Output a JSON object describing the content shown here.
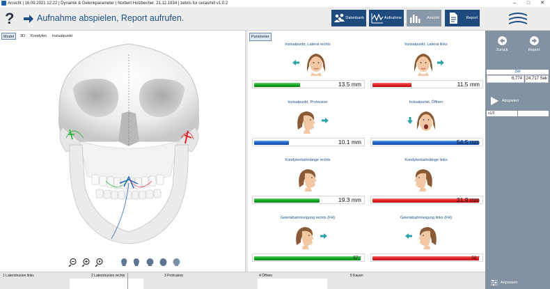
{
  "titlebar": {
    "text": "Ansicht | 16.09.2021 12:22 | Dynamik & Gelenkparameter | Norbert Holzbecher, 21.12.1934 | zebris for cerasmill v1.0.2",
    "minimize": "–",
    "maximize": "□",
    "close": "✕"
  },
  "header": {
    "help_icon": "?",
    "headline": "Aufnahme abspielen, Report aufrufen.",
    "buttons": [
      {
        "label": "Datenbank",
        "icon": "users-icon"
      },
      {
        "label": "Aufnahme",
        "icon": "wave-icon"
      },
      {
        "label": "Ansicht",
        "icon": "bars-icon",
        "active": true
      },
      {
        "label": "Report",
        "icon": "document-icon"
      }
    ]
  },
  "view_tabs": [
    "Model",
    "3D",
    "Kondylen",
    "Inzisalpunkt"
  ],
  "parameter_tab": "Parameter",
  "params": [
    {
      "label": "Inzisalpunkt, Lateral rechts",
      "value": "13.5 mm",
      "color": "#15a322",
      "fill": 0.42
    },
    {
      "label": "Inzisalpunkt, Lateral links",
      "value": "11.5 mm",
      "color": "#e41f24",
      "fill": 0.36
    },
    {
      "label": "Inzisalpunkt, Protrusion",
      "value": "10.1 mm",
      "color": "#1f63c7",
      "fill": 0.32
    },
    {
      "label": "Inzisalpunkt, Öffnen",
      "value": "54.5 mm",
      "color": "#1f63c7",
      "fill": 0.98
    },
    {
      "label": "Kondylenbahnlänge rechts",
      "value": "19.3 mm",
      "color": "#15a322",
      "fill": 0.6
    },
    {
      "label": "Kondylenbahnlänge links",
      "value": "31.9 mm",
      "color": "#e41f24",
      "fill": 0.98
    },
    {
      "label": "Gelenkbahnneigung rechts (FH)",
      "value": "57 °",
      "color": "#15a322",
      "fill": 0.98
    },
    {
      "label": "Gelenkbahnneigung links (FH)",
      "value": "59 °",
      "color": "#e41f24",
      "fill": 0.98
    }
  ],
  "sidebar": {
    "back_label": "Zurück",
    "report_label": "Report",
    "zeit_label": "Zeit",
    "zeit_current": "6,774",
    "zeit_total": "24,717 Sek",
    "play_label": "Abspielen",
    "speed_label": "x1/2",
    "adjust_label": "Anpassen"
  },
  "timeline": [
    "1 Laterotrusion links",
    "2 Laterotrusion rechts",
    "3 Protrusion",
    "4 Öffnen",
    "5 Kauen"
  ]
}
